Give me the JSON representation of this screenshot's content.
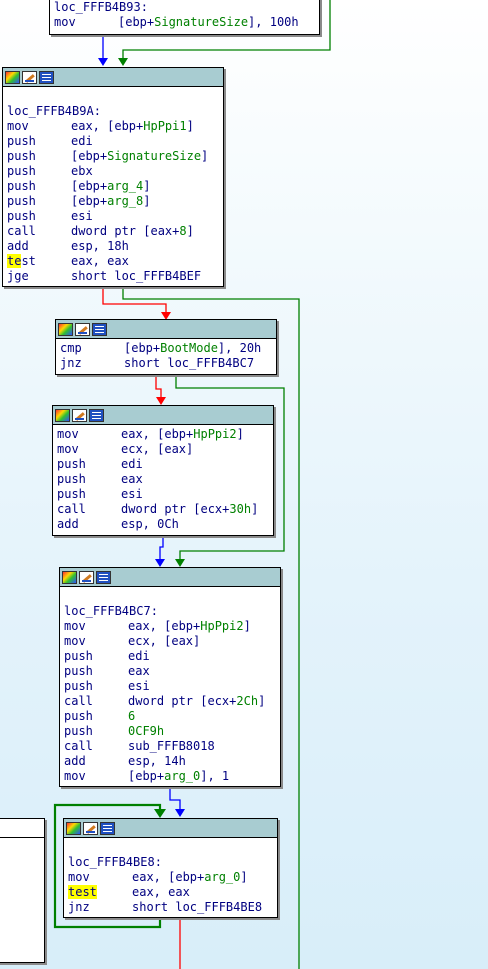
{
  "colors": {
    "true_edge": "#008000",
    "false_edge": "#ff0000",
    "flow_edge": "#0000ff",
    "header_bg": "#a8ccd1",
    "text": "#000080",
    "var": "#008000",
    "highlight": "#ffff00"
  },
  "nodes": [
    {
      "id": "n0",
      "lines": [
        {
          "label": "loc_FFFB4B93:"
        },
        {
          "mn": "mov",
          "op": [
            {
              "t": "[ebp+"
            },
            {
              "t": "SignatureSize",
              "v": true
            },
            {
              "t": "], 100h"
            }
          ]
        }
      ]
    },
    {
      "id": "n1",
      "lines": [
        {
          "blank": true
        },
        {
          "label": "loc_FFFB4B9A:"
        },
        {
          "mn": "mov",
          "op": [
            {
              "t": "eax, [ebp+"
            },
            {
              "t": "HpPpi1",
              "v": true
            },
            {
              "t": "]"
            }
          ]
        },
        {
          "mn": "push",
          "op": [
            {
              "t": "edi"
            }
          ]
        },
        {
          "mn": "push",
          "op": [
            {
              "t": "[ebp+"
            },
            {
              "t": "SignatureSize",
              "v": true
            },
            {
              "t": "]"
            }
          ]
        },
        {
          "mn": "push",
          "op": [
            {
              "t": "ebx"
            }
          ]
        },
        {
          "mn": "push",
          "op": [
            {
              "t": "[ebp+"
            },
            {
              "t": "arg_4",
              "v": true
            },
            {
              "t": "]"
            }
          ]
        },
        {
          "mn": "push",
          "op": [
            {
              "t": "[ebp+"
            },
            {
              "t": "arg_8",
              "v": true
            },
            {
              "t": "]"
            }
          ]
        },
        {
          "mn": "push",
          "op": [
            {
              "t": "esi"
            }
          ]
        },
        {
          "mn": "call",
          "op": [
            {
              "t": "dword ptr [eax+"
            },
            {
              "t": "8",
              "v": true
            },
            {
              "t": "]"
            }
          ]
        },
        {
          "mn": "add",
          "op": [
            {
              "t": "esp, 18h"
            }
          ]
        },
        {
          "mn": "test",
          "hl": "partial",
          "op": [
            {
              "t": "eax, eax"
            }
          ]
        },
        {
          "mn": "jge",
          "op": [
            {
              "t": "short loc_FFFB4BEF"
            }
          ]
        }
      ]
    },
    {
      "id": "n2",
      "lines": [
        {
          "mn": "cmp",
          "op": [
            {
              "t": "[ebp+"
            },
            {
              "t": "BootMode",
              "v": true
            },
            {
              "t": "], 20h"
            }
          ]
        },
        {
          "mn": "jnz",
          "op": [
            {
              "t": "short loc_FFFB4BC7"
            }
          ]
        }
      ]
    },
    {
      "id": "n3",
      "lines": [
        {
          "mn": "mov",
          "op": [
            {
              "t": "eax, [ebp+"
            },
            {
              "t": "HpPpi2",
              "v": true
            },
            {
              "t": "]"
            }
          ]
        },
        {
          "mn": "mov",
          "op": [
            {
              "t": "ecx, [eax]"
            }
          ]
        },
        {
          "mn": "push",
          "op": [
            {
              "t": "edi"
            }
          ]
        },
        {
          "mn": "push",
          "op": [
            {
              "t": "eax"
            }
          ]
        },
        {
          "mn": "push",
          "op": [
            {
              "t": "esi"
            }
          ]
        },
        {
          "mn": "call",
          "op": [
            {
              "t": "dword ptr [ecx+"
            },
            {
              "t": "30h",
              "v": true
            },
            {
              "t": "]"
            }
          ]
        },
        {
          "mn": "add",
          "op": [
            {
              "t": "esp, 0Ch"
            }
          ]
        }
      ]
    },
    {
      "id": "n4",
      "lines": [
        {
          "blank": true
        },
        {
          "label": "loc_FFFB4BC7:"
        },
        {
          "mn": "mov",
          "op": [
            {
              "t": "eax, [ebp+"
            },
            {
              "t": "HpPpi2",
              "v": true
            },
            {
              "t": "]"
            }
          ]
        },
        {
          "mn": "mov",
          "op": [
            {
              "t": "ecx, [eax]"
            }
          ]
        },
        {
          "mn": "push",
          "op": [
            {
              "t": "edi"
            }
          ]
        },
        {
          "mn": "push",
          "op": [
            {
              "t": "eax"
            }
          ]
        },
        {
          "mn": "push",
          "op": [
            {
              "t": "esi"
            }
          ]
        },
        {
          "mn": "call",
          "op": [
            {
              "t": "dword ptr [ecx+"
            },
            {
              "t": "2Ch",
              "v": true
            },
            {
              "t": "]"
            }
          ]
        },
        {
          "mn": "push",
          "op": [
            {
              "t": "6",
              "v": true
            }
          ]
        },
        {
          "mn": "push",
          "op": [
            {
              "t": "0CF9h",
              "v": true
            }
          ]
        },
        {
          "mn": "call",
          "op": [
            {
              "t": "sub_FFFB8018"
            }
          ]
        },
        {
          "mn": "add",
          "op": [
            {
              "t": "esp, 14h"
            }
          ]
        },
        {
          "mn": "mov",
          "op": [
            {
              "t": "[ebp+"
            },
            {
              "t": "arg_0",
              "v": true
            },
            {
              "t": "], 1"
            }
          ]
        }
      ]
    },
    {
      "id": "n5",
      "lines": [
        {
          "blank": true
        },
        {
          "label": "loc_FFFB4BE8:"
        },
        {
          "mn": "mov",
          "op": [
            {
              "t": "eax, [ebp+"
            },
            {
              "t": "arg_0",
              "v": true
            },
            {
              "t": "]"
            }
          ]
        },
        {
          "mn": "test",
          "hl": "full",
          "op": [
            {
              "t": "eax, eax"
            }
          ]
        },
        {
          "mn": "jnz",
          "op": [
            {
              "t": "short loc_FFFB4BE8"
            }
          ]
        }
      ]
    }
  ]
}
